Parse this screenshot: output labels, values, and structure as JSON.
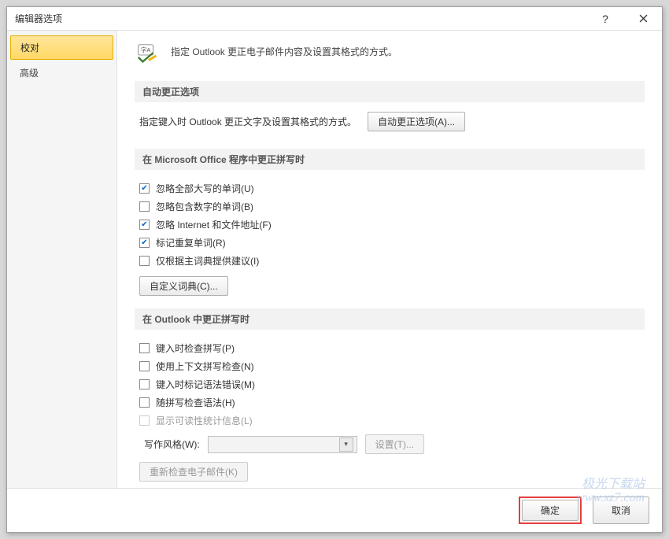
{
  "window": {
    "title": "编辑器选项"
  },
  "sidebar": {
    "items": [
      {
        "label": "校对",
        "active": true
      },
      {
        "label": "高级",
        "active": false
      }
    ]
  },
  "header": {
    "description": "指定 Outlook 更正电子邮件内容及设置其格式的方式。"
  },
  "section_autocorrect": {
    "title": "自动更正选项",
    "text": "指定键入时 Outlook 更正文字及设置其格式的方式。",
    "button": "自动更正选项(A)..."
  },
  "section_office_spelling": {
    "title": "在 Microsoft Office 程序中更正拼写时",
    "checks": [
      {
        "label": "忽略全部大写的单词(U)",
        "checked": true
      },
      {
        "label": "忽略包含数字的单词(B)",
        "checked": false
      },
      {
        "label": "忽略 Internet 和文件地址(F)",
        "checked": true
      },
      {
        "label": "标记重复单词(R)",
        "checked": true
      },
      {
        "label": "仅根据主词典提供建议(I)",
        "checked": false
      }
    ],
    "custom_dict_btn": "自定义词典(C)..."
  },
  "section_outlook_spelling": {
    "title": "在 Outlook 中更正拼写时",
    "checks": [
      {
        "label": "键入时检查拼写(P)",
        "checked": false,
        "disabled": false
      },
      {
        "label": "使用上下文拼写检查(N)",
        "checked": false,
        "disabled": false
      },
      {
        "label": "键入时标记语法错误(M)",
        "checked": false,
        "disabled": false
      },
      {
        "label": "随拼写检查语法(H)",
        "checked": false,
        "disabled": false
      },
      {
        "label": "显示可读性统计信息(L)",
        "checked": false,
        "disabled": true
      }
    ],
    "writing_style_label": "写作风格(W):",
    "settings_btn": "设置(T)...",
    "recheck_btn": "重新检查电子邮件(K)"
  },
  "footer": {
    "ok": "确定",
    "cancel": "取消"
  },
  "watermark": {
    "line1": "极光下载站",
    "line2": "www.xz7.com"
  }
}
